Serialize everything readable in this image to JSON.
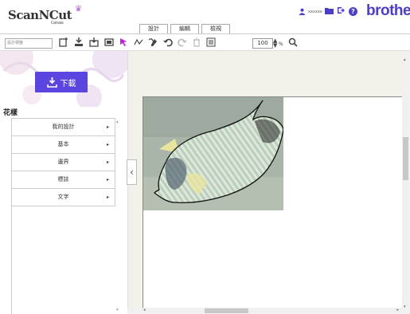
{
  "app": {
    "logo_text": "ScanNCut",
    "logo_sub": "Canvas",
    "brand": "brother"
  },
  "tabs": [
    {
      "label": "設計"
    },
    {
      "label": "編輯"
    },
    {
      "label": "檢視"
    }
  ],
  "header": {
    "user_name": "xxxxxx"
  },
  "toolbar": {
    "search_placeholder": "設計標籤",
    "zoom_value": "100",
    "zoom_unit": "%"
  },
  "left_panel": {
    "download_label": "下載",
    "category_title": "花樣",
    "categories": [
      {
        "label": "我的設計"
      },
      {
        "label": "基本"
      },
      {
        "label": "邊界"
      },
      {
        "label": "標誌"
      },
      {
        "label": "文字"
      }
    ]
  },
  "icons": {
    "accent": "#4c3fc4",
    "download_bg": "#5b45e0",
    "selection_tool": "#c020e0"
  }
}
